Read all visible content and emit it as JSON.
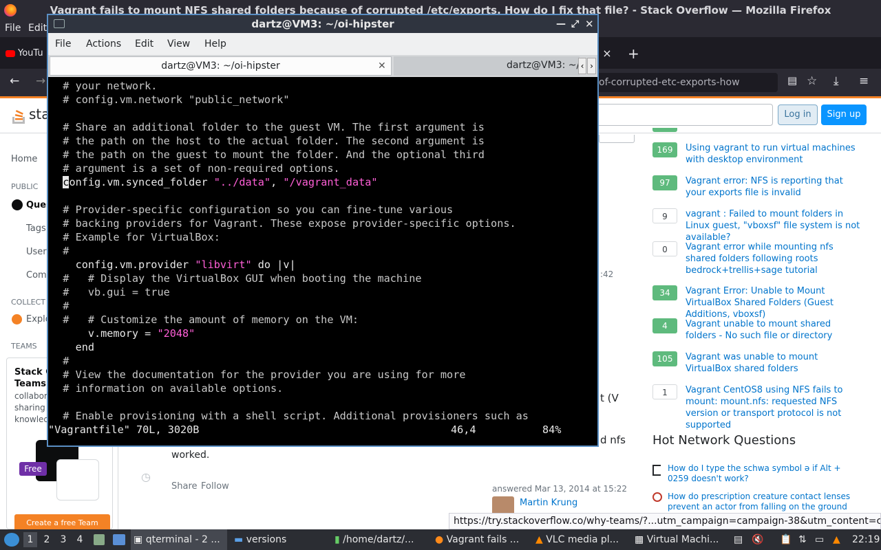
{
  "firefox": {
    "window_title": "Vagrant fails to mount NFS shared folders because of corrupted /etc/exports. How do I fix that file? - Stack Overflow — Mozilla Firefox",
    "menu": [
      "File",
      "Edit"
    ],
    "tab_youtube": "YouTu",
    "new_tab": "+",
    "tab_close": "×",
    "url_tail": "of-corrupted-etc-exports-how"
  },
  "so": {
    "logo_text": "sta",
    "login": "Log in",
    "signup": "Sign up",
    "left_nav": {
      "home": "Home",
      "public": "PUBLIC",
      "questions": "Ques",
      "tags": "Tags",
      "users": "User",
      "companies": "Comp",
      "collectives": "COLLECT",
      "explore": "Explo",
      "teams": "TEAMS",
      "teams_title1": "Stack O",
      "teams_title2": "Teams",
      "teams_desc": [
        "collabor",
        "sharing",
        "knowled"
      ],
      "free_badge": "Free",
      "create_team": "Create a free Team"
    },
    "main": {
      "time_frag": ":42",
      "frag_v": "t (V",
      "frag_nfs": "d nfs",
      "worked": "worked.",
      "share": "Share",
      "follow": "Follow",
      "answered": "answered Mar 13, 2014 at 15:22",
      "user": "Martin Krung"
    },
    "related": [
      {
        "score": "169",
        "title": "Using vagrant to run virtual machines with desktop environment"
      },
      {
        "score": "97",
        "title": "Vagrant error: NFS is reporting that your exports file is invalid"
      },
      {
        "score": "9",
        "title": "vagrant : Failed to mount folders in Linux guest, \"vboxsf\" file system is not available?"
      },
      {
        "score": "0",
        "title": "Vagrant error while mounting nfs shared folders following roots bedrock+trellis+sage tutorial"
      },
      {
        "score": "34",
        "title": "Vagrant Error: Unable to Mount VirtualBox Shared Folders (Guest Additions, vboxsf)"
      },
      {
        "score": "4",
        "title": "Vagrant unable to mount shared folders - No such file or directory"
      },
      {
        "score": "105",
        "title": "Vagrant was unable to mount VirtualBox shared folders"
      },
      {
        "score": "1",
        "title": "Vagrant CentOS8 using NFS fails to mount: mount.nfs: requested NFS version or transport protocol is not supported"
      }
    ],
    "hnq_heading": "Hot Network Questions",
    "hnq": [
      "How do I type the schwa symbol ə if Alt + 0259 doesn't work?",
      "How do prescription creature contact lenses prevent an actor from falling on the ground while"
    ],
    "status_url": "https://try.stackoverflow.co/why-teams/?...utm_campaign=campaign-38&utm_content=cta"
  },
  "terminal": {
    "title": "dartz@VM3: ~/oi-hipster",
    "menu": [
      "File",
      "Actions",
      "Edit",
      "View",
      "Help"
    ],
    "tab1": "dartz@VM3: ~/oi-hipster",
    "tab2": "dartz@VM3: ~/",
    "lines": [
      {
        "c": "  # your network."
      },
      {
        "c": "  # config.vm.network \"public_network\""
      },
      {
        "c": ""
      },
      {
        "c": "  # Share an additional folder to the guest VM. The first argument is"
      },
      {
        "c": "  # the path on the host to the actual folder. The second argument is"
      },
      {
        "c": "  # the path on the guest to mount the folder. And the optional third"
      },
      {
        "c": "  # argument is a set of non-required options."
      },
      {
        "pre": "  ",
        "cur": "c",
        "t": "onfig.vm.synced_folder ",
        "s1": "\"../data\"",
        "m": ", ",
        "s2": "\"/vagrant_data\""
      },
      {
        "c": ""
      },
      {
        "c": "  # Provider-specific configuration so you can fine-tune various"
      },
      {
        "c": "  # backing providers for Vagrant. These expose provider-specific options."
      },
      {
        "c": "  # Example for VirtualBox:"
      },
      {
        "c": "  #"
      },
      {
        "t": "    config.vm.provider ",
        "s1": "\"libvirt\"",
        "m": " do |v|"
      },
      {
        "c": "  #   # Display the VirtualBox GUI when booting the machine"
      },
      {
        "c": "  #   vb.gui = true"
      },
      {
        "c": "  #"
      },
      {
        "c": "  #   # Customize the amount of memory on the VM:"
      },
      {
        "t": "      v.memory = ",
        "s1": "\"2048\""
      },
      {
        "t": "    end"
      },
      {
        "c": "  #"
      },
      {
        "c": "  # View the documentation for the provider you are using for more"
      },
      {
        "c": "  # information on available options."
      },
      {
        "c": ""
      },
      {
        "c": "  # Enable provisioning with a shell script. Additional provisioners such as"
      }
    ],
    "status_file": "\"Vagrantfile\" 70L, 3020B",
    "status_pos": "46,4",
    "status_pct": "84%"
  },
  "taskbar": {
    "workspaces": [
      "1",
      "2",
      "3",
      "4"
    ],
    "items": [
      "qterminal - 2 ...",
      "versions",
      "/home/dartz/...",
      "Vagrant fails ...",
      "VLC media pl...",
      "Virtual Machi..."
    ],
    "clock": "22:19"
  }
}
